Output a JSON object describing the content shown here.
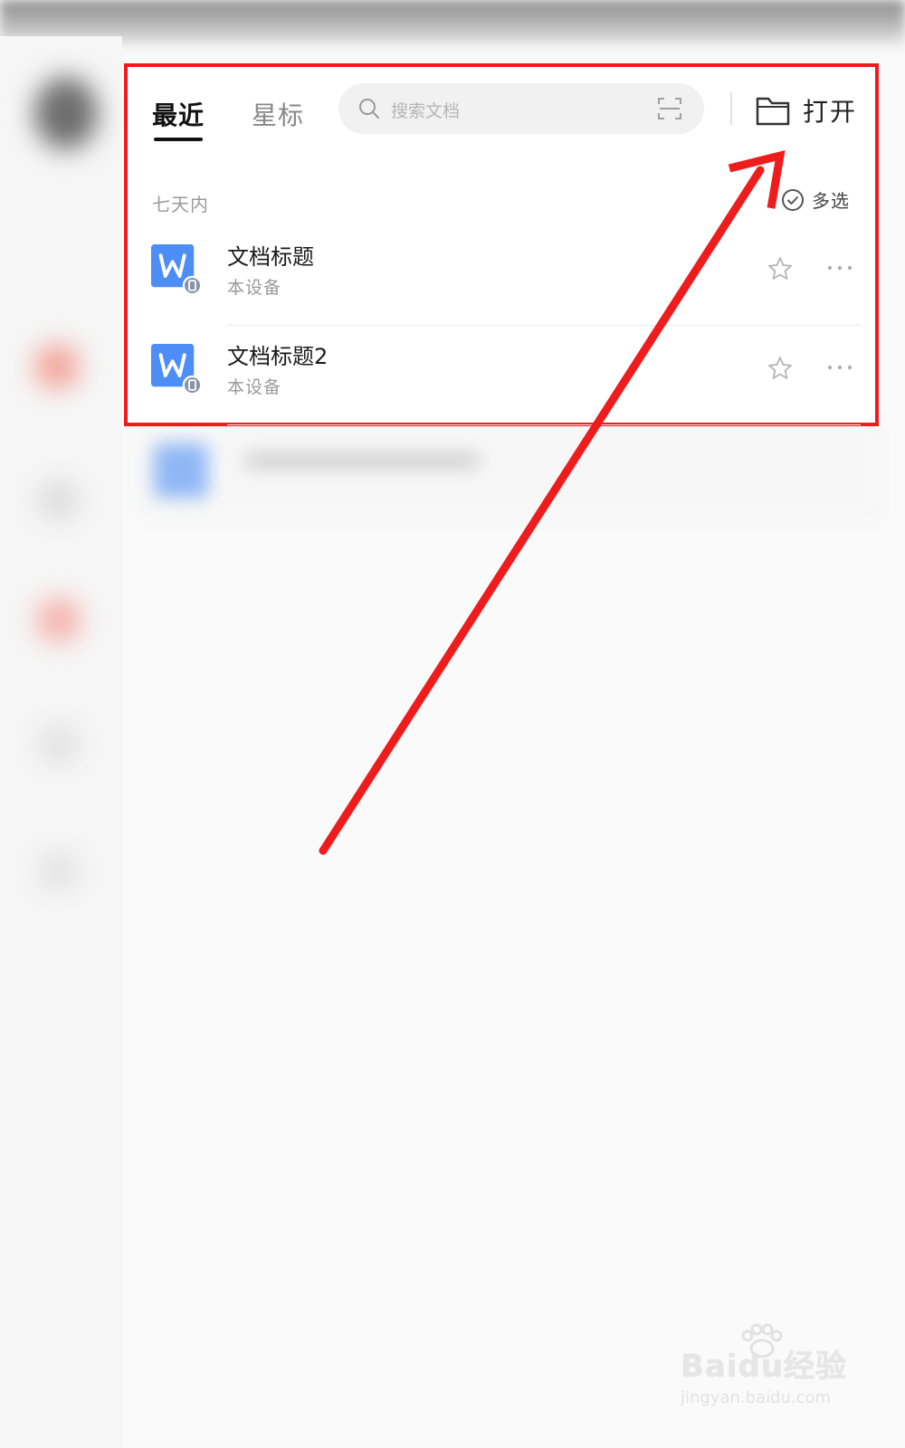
{
  "tabs": {
    "recent": "最近",
    "starred": "星标"
  },
  "search": {
    "placeholder": "搜索文档"
  },
  "open": {
    "label": "打开"
  },
  "section": {
    "title": "七天内",
    "multi_select": "多选"
  },
  "files": [
    {
      "title": "文档标题",
      "location": "本设备"
    },
    {
      "title": "文档标题2",
      "location": "本设备"
    }
  ],
  "watermark": {
    "brand": "Baidu经验",
    "url": "jingyan.baidu.com"
  },
  "colors": {
    "highlight": "#ee1c1c",
    "word_blue": "#4c8df6",
    "badge": "#8a93a6"
  },
  "icons": [
    "search-icon",
    "scan-icon",
    "folder-icon",
    "check-circle-icon",
    "word-doc-icon",
    "device-badge-icon",
    "star-icon",
    "more-icon"
  ]
}
